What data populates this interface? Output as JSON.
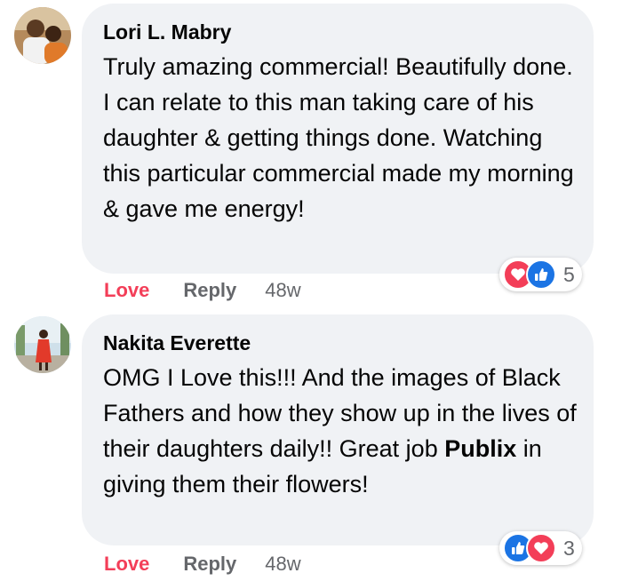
{
  "comments": [
    {
      "author": "Lori L. Mabry",
      "text_parts": [
        "Truly amazing commercial! Beautifully done. I can relate to this man taking care of his daughter & getting things done. Watching this particular commercial made my morning & gave me energy!"
      ],
      "reactions": {
        "icons": [
          "love-icon",
          "like-icon"
        ],
        "count": "5"
      },
      "actions": {
        "love": "Love",
        "reply": "Reply",
        "time": "48w"
      }
    },
    {
      "author": "Nakita Everette",
      "text_parts": [
        "OMG I Love this!!! And the images of Black Fathers and how they show up in the lives of their daughters daily!! Great job ",
        "Publix",
        " in giving them their flowers!"
      ],
      "reactions": {
        "icons": [
          "like-icon",
          "love-icon"
        ],
        "count": "3"
      },
      "actions": {
        "love": "Love",
        "reply": "Reply",
        "time": "48w"
      }
    }
  ],
  "colors": {
    "bubble": "#f0f2f5",
    "love_red": "#f33e58",
    "like_blue": "#1b74e4",
    "meta_gray": "#65676b"
  }
}
